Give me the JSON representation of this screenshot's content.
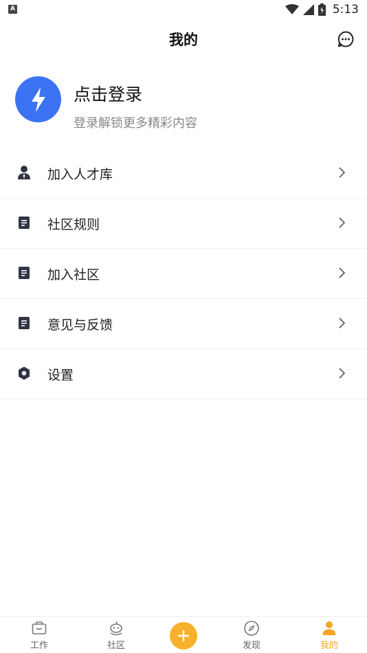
{
  "status_bar": {
    "indicator": "A",
    "time": "5:13"
  },
  "header": {
    "title": "我的"
  },
  "profile": {
    "title": "点击登录",
    "subtitle": "登录解锁更多精彩内容"
  },
  "menu": [
    {
      "label": "加入人才库",
      "icon": "person-icon"
    },
    {
      "label": "社区规则",
      "icon": "document-icon"
    },
    {
      "label": "加入社区",
      "icon": "document-icon"
    },
    {
      "label": "意见与反馈",
      "icon": "document-icon"
    },
    {
      "label": "设置",
      "icon": "hexagon-settings-icon"
    }
  ],
  "bottom_nav": {
    "items": [
      {
        "label": "工作",
        "icon": "briefcase-icon"
      },
      {
        "label": "社区",
        "icon": "community-icon"
      },
      {
        "label": "",
        "icon": "plus-icon"
      },
      {
        "label": "发现",
        "icon": "compass-icon"
      },
      {
        "label": "我的",
        "icon": "person-icon"
      }
    ],
    "active": "我的"
  },
  "colors": {
    "accent": "#f5a623",
    "avatar": "#3b73f2",
    "icon_dark": "#2f3542"
  }
}
